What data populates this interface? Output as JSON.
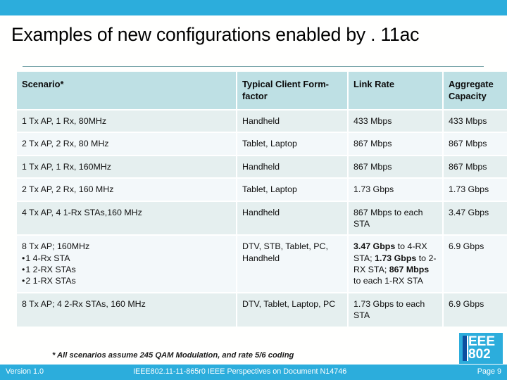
{
  "slide": {
    "title": "Examples of new configurations enabled by . 11ac",
    "footnote": "* All scenarios assume 245 QAM Modulation, and rate 5/6 coding",
    "accent_color": "#2CADDC",
    "header_color": "#BEE0E4",
    "row_color_a": "#E5EFEF",
    "row_color_b": "#F3F8FA"
  },
  "table": {
    "headers": [
      "Scenario*",
      "Typical Client Form-factor",
      "Link Rate",
      "Aggregate Capacity"
    ],
    "rows": [
      {
        "scenario": "1 Tx AP, 1 Rx, 80MHz",
        "form_factor": "Handheld",
        "link_rate": "433 Mbps",
        "aggregate": "433 Mbps"
      },
      {
        "scenario": "2 Tx AP, 2 Rx, 80 MHz",
        "form_factor": "Tablet, Laptop",
        "link_rate": "867 Mbps",
        "aggregate": "867 Mbps"
      },
      {
        "scenario": "1 Tx AP, 1 Rx, 160MHz",
        "form_factor": "Handheld",
        "link_rate": "867 Mbps",
        "aggregate": "867 Mbps"
      },
      {
        "scenario": "2 Tx AP, 2 Rx, 160 MHz",
        "form_factor": "Tablet, Laptop",
        "link_rate": "1.73 Gbps",
        "aggregate": "1.73 Gbps"
      },
      {
        "scenario": "4 Tx AP, 4 1-Rx STAs,160 MHz",
        "form_factor": "Handheld",
        "link_rate": "867 Mbps to each STA",
        "aggregate": "3.47 Gbps"
      },
      {
        "scenario": "8 Tx AP; 160MHz",
        "scenario_bullets": [
          "1 4-Rx STA",
          "1 2-RX STAs",
          "2 1-RX STAs"
        ],
        "form_factor": "DTV, STB, Tablet, PC, Handheld",
        "link_rate_parts": [
          {
            "bold": "3.47 Gbps",
            "rest": " to 4-RX STA;"
          },
          {
            "bold": "1.73 Gbps",
            "rest": " to 2-RX STA;"
          },
          {
            "bold": "867 Mbps",
            "rest": " to each 1-RX STA"
          }
        ],
        "aggregate": "6.9 Gbps"
      },
      {
        "scenario": "8 Tx AP; 4 2-Rx STAs, 160 MHz",
        "form_factor": "DTV, Tablet, Laptop, PC",
        "link_rate": "1.73 Gbps to each STA",
        "aggregate": "6.9 Gbps"
      }
    ]
  },
  "logo": {
    "line1": "EEE",
    "line2": "802"
  },
  "footer": {
    "version": "Version 1.0",
    "center": "IEEE802.11-11-865r0  IEEE Perspectives on Document N14746",
    "page": "Page 9"
  }
}
